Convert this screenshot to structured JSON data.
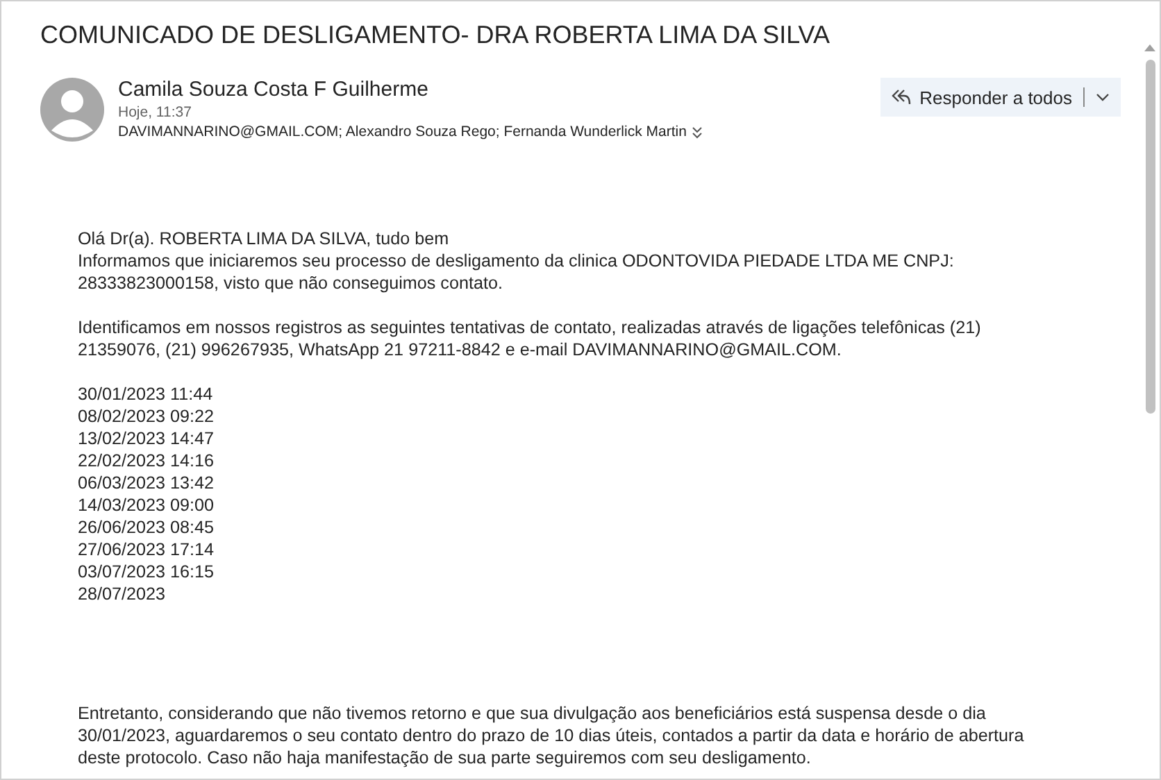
{
  "subject": "COMUNICADO DE DESLIGAMENTO- DRA ROBERTA LIMA DA SILVA",
  "sender": {
    "name": "Camila Souza Costa F Guilherme",
    "time": "Hoje, 11:37",
    "recipients": "DAVIMANNARINO@GMAIL.COM; Alexandro Souza Rego; Fernanda Wunderlick Martin"
  },
  "reply_button": {
    "label": "Responder a todos"
  },
  "body": [
    {
      "lines": [
        "Olá Dr(a). ROBERTA LIMA DA SILVA, tudo bem",
        "Informamos que iniciaremos seu processo de desligamento da clinica ODONTOVIDA PIEDADE LTDA ME CNPJ:",
        "28333823000158, visto que não conseguimos contato."
      ]
    },
    {
      "lines": [
        "Identificamos em nossos registros as seguintes tentativas de contato, realizadas através de ligações telefônicas (21)",
        "21359076, (21) 996267935, WhatsApp 21 97211-8842 e e-mail DAVIMANNARINO@GMAIL.COM."
      ]
    },
    {
      "lines": [
        "30/01/2023 11:44",
        "08/02/2023 09:22",
        "13/02/2023 14:47",
        "22/02/2023 14:16",
        "06/03/2023 13:42",
        "14/03/2023 09:00",
        "26/06/2023 08:45",
        "27/06/2023 17:14",
        "03/07/2023 16:15",
        "28/07/2023"
      ]
    },
    {
      "lines": [
        "Entretanto, considerando que não tivemos retorno e que sua divulgação aos beneficiários está suspensa desde o dia",
        "30/01/2023, aguardaremos o seu contato dentro do prazo de 10 dias úteis, contados a partir da data e horário de abertura",
        "deste protocolo. Caso não haja manifestação de sua parte seguiremos com seu desligamento."
      ]
    }
  ]
}
